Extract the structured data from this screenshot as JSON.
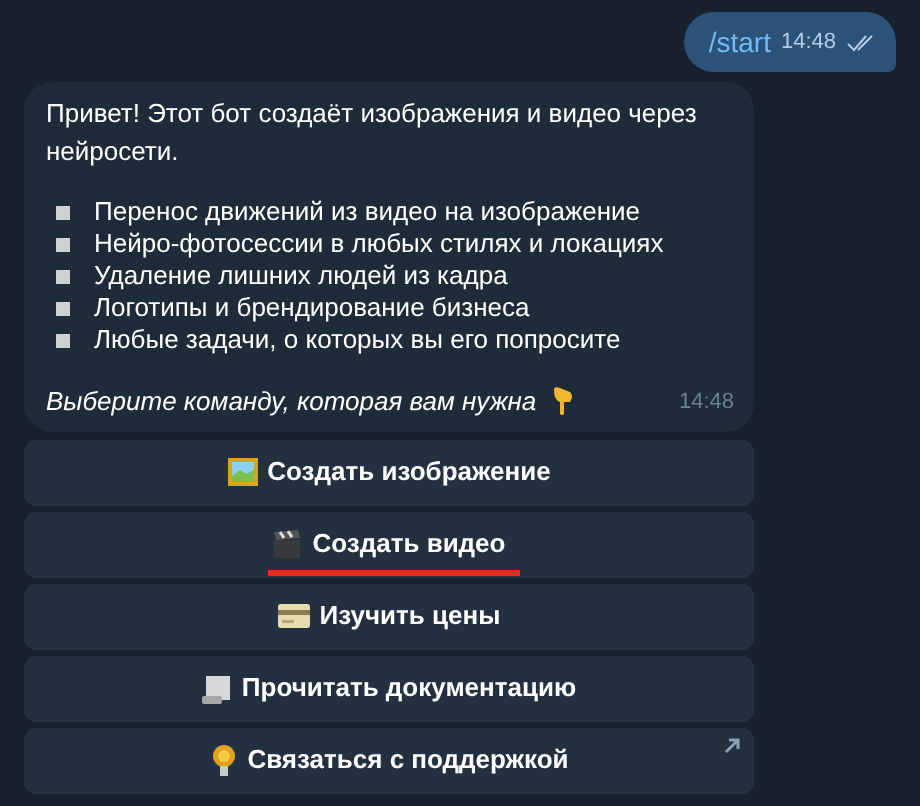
{
  "outgoing": {
    "text": "/start",
    "time": "14:48",
    "read": true
  },
  "incoming": {
    "intro": "Привет! Этот бот создаёт изображения и видео через нейросети.",
    "bullets": [
      "Перенос движений из видео на изображение",
      "Нейро-фотосессии в любых стилях и локациях",
      "Удаление лишних людей из кадра",
      "Логотипы и брендирование бизнеса",
      "Любые задачи, о которых вы его попросите"
    ],
    "prompt": "Выберите команду, которая вам нужна",
    "time": "14:48"
  },
  "buttons": [
    {
      "label": "Создать изображение",
      "kind": "callback",
      "highlighted": false
    },
    {
      "label": "Создать видео",
      "kind": "callback",
      "highlighted": true
    },
    {
      "label": "Изучить цены",
      "kind": "callback",
      "highlighted": false
    },
    {
      "label": "Прочитать документацию",
      "kind": "callback",
      "highlighted": false
    },
    {
      "label": "Связаться с поддержкой",
      "kind": "url",
      "highlighted": false
    }
  ]
}
